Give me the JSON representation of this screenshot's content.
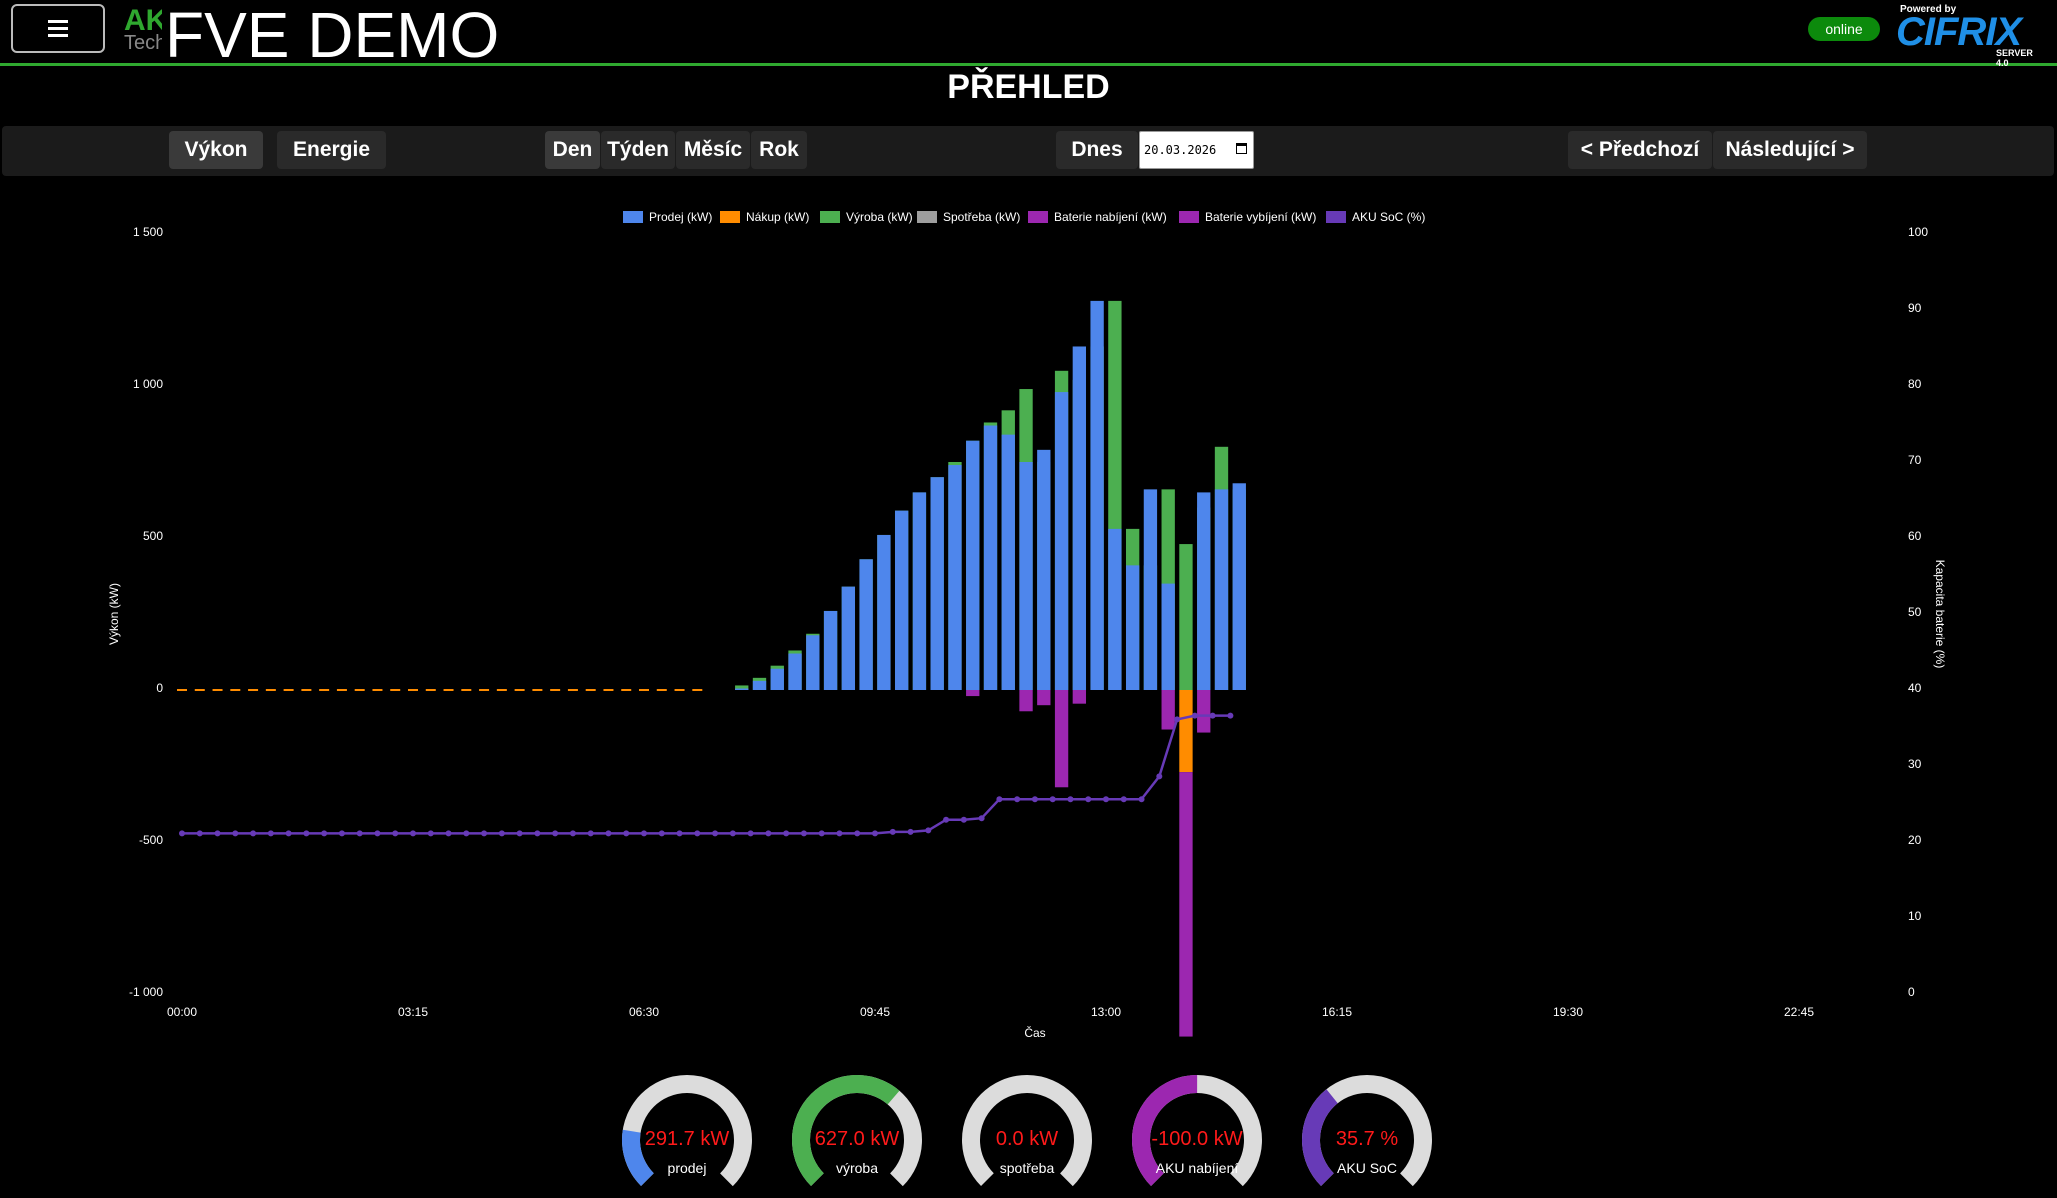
{
  "header": {
    "menu_icon": "hamburger-icon",
    "logo_text_top": "AK",
    "logo_text_bottom": "Tech",
    "title": "FVE DEMO",
    "status": "online",
    "brand_powered": "Powered by",
    "brand_name": "CIFRIX",
    "brand_server": "SERVER 4.0"
  },
  "page_title": "PŘEHLED",
  "toolbar": {
    "view_tabs": [
      "Výkon",
      "Energie"
    ],
    "period_tabs": [
      "Den",
      "Týden",
      "Měsíc",
      "Rok"
    ],
    "active_period": "Den",
    "today_label": "Dnes",
    "date_value": "20.03.2026",
    "prev_label": "< Předchozí",
    "next_label": "Následující >"
  },
  "colors": {
    "accent_green": "#2fa82f",
    "sell": "#4e86ec",
    "buy": "#ff8c00",
    "production": "#4caf50",
    "consumption": "#9e9e9e",
    "charge": "#9c27b0",
    "discharge": "#9c27b0",
    "soc": "#673ab7"
  },
  "chart_data": {
    "type": "bar",
    "title": "",
    "xlabel": "Čas",
    "ylabel": "Výkon (kW)",
    "y2label": "Kapacita baterie (%)",
    "ylim": [
      -1000,
      1500
    ],
    "y2lim": [
      0,
      100
    ],
    "y_ticks": [
      "1 500",
      "1 000",
      "500",
      "0",
      "-500",
      "-1 000"
    ],
    "y2_ticks": [
      "100",
      "90",
      "80",
      "70",
      "60",
      "50",
      "40",
      "30",
      "20",
      "10",
      "0"
    ],
    "x_ticks": [
      "00:00",
      "03:15",
      "06:30",
      "09:45",
      "13:00",
      "16:15",
      "19:30",
      "22:45"
    ],
    "legend": [
      "Prodej (kW)",
      "Nákup (kW)",
      "Výroba (kW)",
      "Spotřeba (kW)",
      "Baterie nabíjení (kW)",
      "Baterie vybíjení (kW)",
      "AKU SoC (%)"
    ],
    "legend_position": "top",
    "interval_minutes": 15,
    "sell": [
      0,
      0,
      0,
      0,
      0,
      0,
      0,
      0,
      0,
      0,
      0,
      0,
      0,
      0,
      0,
      0,
      0,
      0,
      0,
      0,
      0,
      0,
      0,
      0,
      0,
      0,
      0,
      0,
      0,
      0,
      0,
      5,
      30,
      70,
      120,
      180,
      260,
      340,
      430,
      510,
      590,
      650,
      700,
      740,
      820,
      870,
      840,
      750,
      790,
      980,
      1130,
      1280,
      530,
      410,
      660,
      350,
      0,
      650,
      660,
      680
    ],
    "buy": [
      0,
      0,
      0,
      0,
      0,
      0,
      0,
      0,
      0,
      0,
      0,
      0,
      0,
      0,
      0,
      0,
      0,
      0,
      0,
      0,
      0,
      0,
      0,
      0,
      0,
      0,
      0,
      0,
      0,
      0,
      0,
      0,
      0,
      0,
      0,
      0,
      0,
      0,
      0,
      0,
      0,
      0,
      0,
      0,
      0,
      0,
      0,
      0,
      0,
      0,
      0,
      0,
      0,
      0,
      0,
      0,
      -270,
      0,
      0,
      0
    ],
    "production": [
      0,
      0,
      0,
      0,
      0,
      0,
      0,
      0,
      0,
      0,
      0,
      0,
      0,
      0,
      0,
      0,
      0,
      0,
      0,
      0,
      0,
      0,
      0,
      0,
      0,
      0,
      0,
      0,
      0,
      0,
      0,
      15,
      40,
      80,
      130,
      185,
      260,
      340,
      430,
      510,
      590,
      650,
      700,
      750,
      820,
      880,
      920,
      990,
      750,
      1050,
      1020,
      1130,
      1280,
      530,
      410,
      660,
      480,
      600,
      800,
      660,
      680
    ],
    "consumption": [
      0,
      0,
      0,
      0,
      0,
      0,
      0,
      0,
      0,
      0,
      0,
      0,
      0,
      0,
      0,
      0,
      0,
      0,
      0,
      0,
      0,
      0,
      0,
      0,
      0,
      0,
      0,
      0,
      0,
      0,
      0,
      0,
      0,
      0,
      0,
      0,
      0,
      0,
      0,
      0,
      0,
      0,
      0,
      0,
      0,
      0,
      0,
      0,
      0,
      0,
      0,
      0,
      0,
      0,
      0,
      0,
      0,
      0,
      0,
      0
    ],
    "battery_charge": [
      0,
      0,
      0,
      0,
      0,
      0,
      0,
      0,
      0,
      0,
      0,
      0,
      0,
      0,
      0,
      0,
      0,
      0,
      0,
      0,
      0,
      0,
      0,
      0,
      0,
      0,
      0,
      0,
      0,
      0,
      0,
      0,
      0,
      0,
      0,
      0,
      0,
      0,
      0,
      0,
      0,
      0,
      0,
      0,
      -20,
      0,
      0,
      -70,
      -50,
      -320,
      -45,
      0,
      0,
      0,
      0,
      -130,
      -870,
      -140,
      0,
      0
    ],
    "battery_discharge": [
      0,
      0,
      0,
      0,
      0,
      0,
      0,
      0,
      0,
      0,
      0,
      0,
      0,
      0,
      0,
      0,
      0,
      0,
      0,
      0,
      0,
      0,
      0,
      0,
      0,
      0,
      0,
      0,
      0,
      0,
      0,
      0,
      0,
      0,
      0,
      0,
      0,
      0,
      0,
      0,
      0,
      0,
      0,
      0,
      0,
      0,
      0,
      0,
      0,
      0,
      0,
      0,
      0,
      0,
      0,
      0,
      0,
      0,
      0,
      0
    ],
    "soc": [
      21,
      21,
      21,
      21,
      21,
      21,
      21,
      21,
      21,
      21,
      21,
      21,
      21,
      21,
      21,
      21,
      21,
      21,
      21,
      21,
      21,
      21,
      21,
      21,
      21,
      21,
      21,
      21,
      21,
      21,
      21,
      21,
      21,
      21,
      21,
      21,
      21,
      21,
      21,
      21,
      21.2,
      21.2,
      21.4,
      22.8,
      22.8,
      23,
      25.5,
      25.5,
      25.5,
      25.5,
      25.5,
      25.5,
      25.5,
      25.5,
      25.5,
      28.5,
      36,
      36.5,
      36.5,
      36.5
    ]
  },
  "gauges": [
    {
      "value": "291.7 kW",
      "label": "prodej",
      "fraction": 0.2,
      "color": "#4e86ec",
      "icon": "gauge-icon"
    },
    {
      "value": "627.0 kW",
      "label": "výroba",
      "fraction": 0.65,
      "color": "#4caf50",
      "icon": "gauge-icon"
    },
    {
      "value": "0.0 kW",
      "label": "spotřeba",
      "fraction": 0.0,
      "color": "#9e9e9e",
      "icon": "gauge-icon"
    },
    {
      "value": "-100.0 kW",
      "label": "AKU nabíjení",
      "fraction": 0.5,
      "color": "#9c27b0",
      "icon": "gauge-icon"
    },
    {
      "value": "35.7 %",
      "label": "AKU SoC",
      "fraction": 0.357,
      "color": "#673ab7",
      "icon": "gauge-icon"
    }
  ]
}
